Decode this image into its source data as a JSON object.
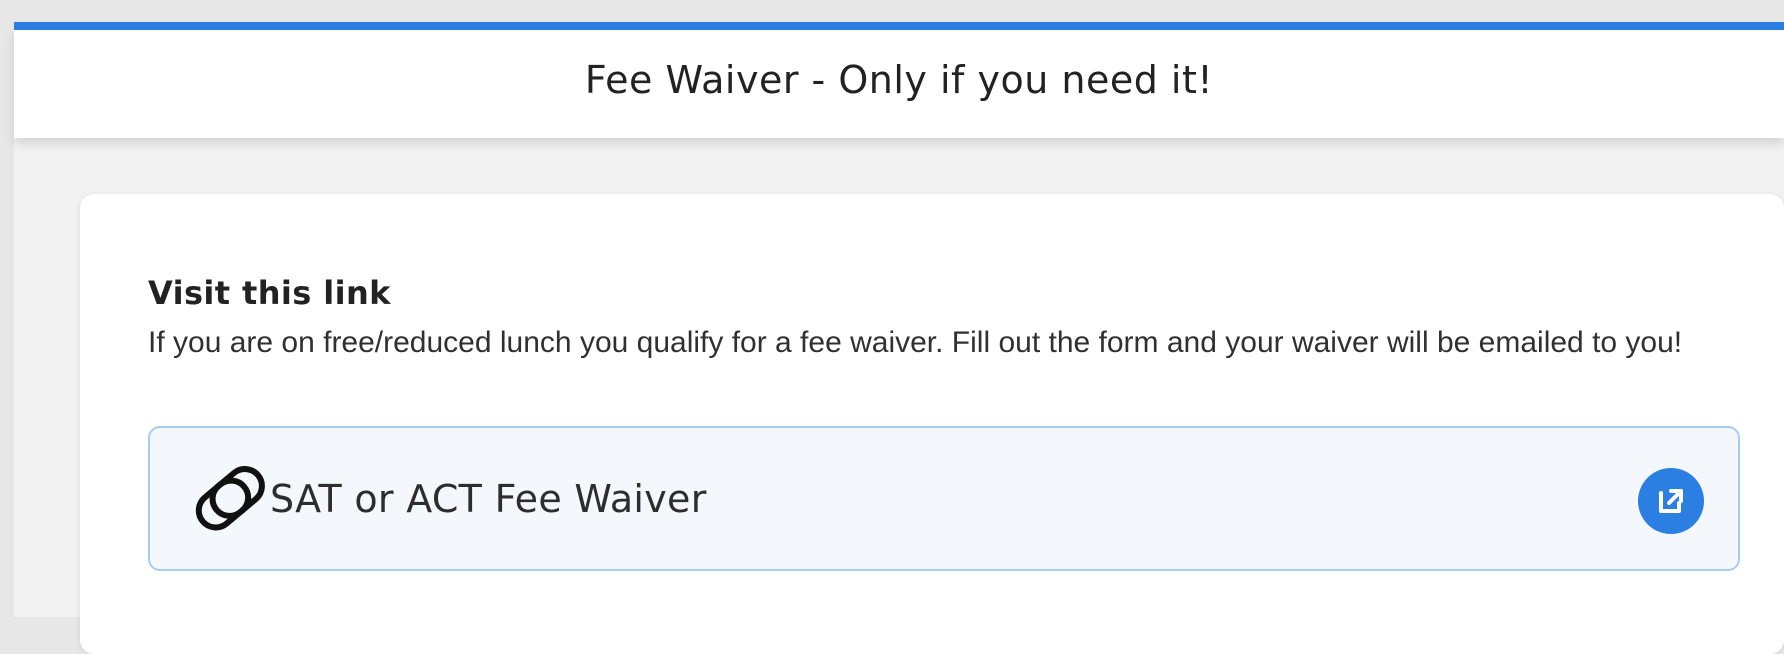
{
  "header": {
    "title": "Fee Waiver - Only if you need it!"
  },
  "card": {
    "heading": "Visit this link",
    "description": "If you are on free/reduced lunch you qualify for a fee waiver. Fill out the form and your waiver will be emailed to you!",
    "link": {
      "label": "SAT or ACT Fee Waiver",
      "icon": "link-icon",
      "action_icon": "external-link-icon"
    }
  },
  "colors": {
    "accent": "#2b7fe3",
    "link_box_bg": "#f4f8fd",
    "link_box_border": "#a9ccf1"
  }
}
